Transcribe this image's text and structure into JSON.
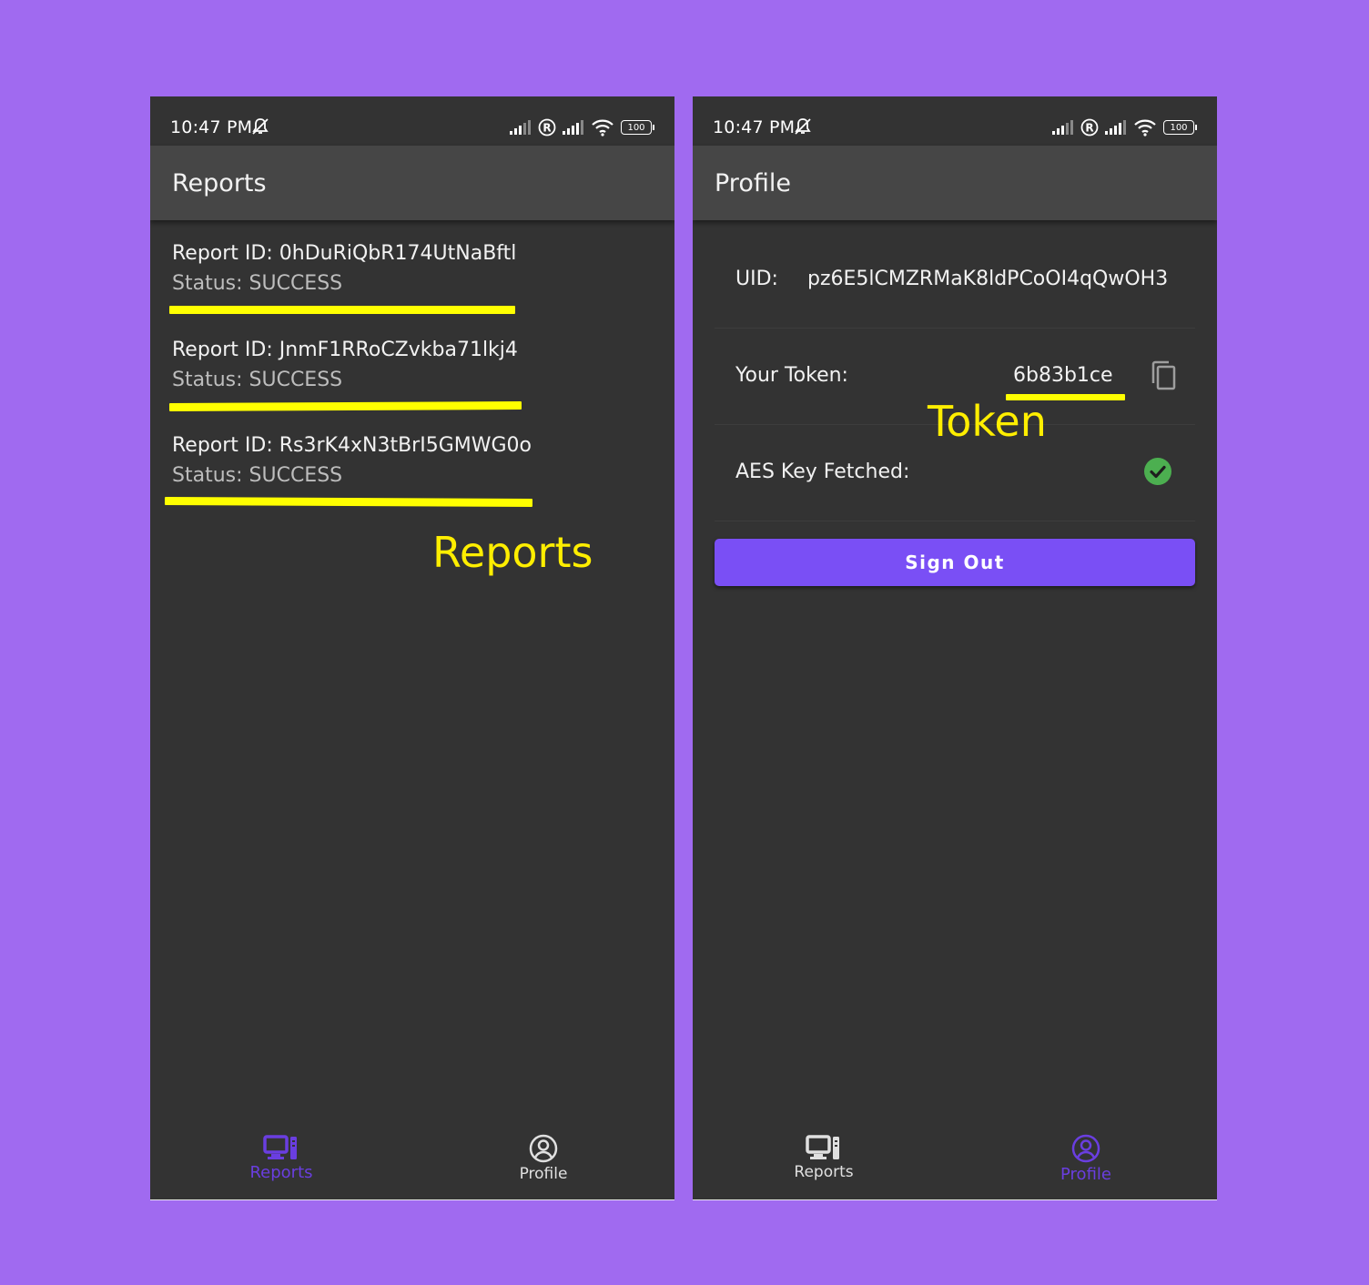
{
  "colors": {
    "background": "#a06af0",
    "surface": "#333333",
    "appbar": "#464646",
    "accent": "#7a4ff5",
    "highlight": "#ffff00",
    "success": "#4caf50"
  },
  "status_bar": {
    "time": "10:47 PM",
    "battery": "100",
    "icons": [
      "mute-icon",
      "signal-icon",
      "registered-icon",
      "signal-icon",
      "wifi-icon",
      "battery-icon"
    ]
  },
  "left_screen": {
    "title": "Reports",
    "reports": [
      {
        "id_label": "Report ID: 0hDuRiQbR174UtNaBftl",
        "status_label": "Status: SUCCESS"
      },
      {
        "id_label": "Report ID: JnmF1RRoCZvkba71lkj4",
        "status_label": "Status: SUCCESS"
      },
      {
        "id_label": "Report ID: Rs3rK4xN3tBrI5GMWG0o",
        "status_label": "Status: SUCCESS"
      }
    ],
    "annotation": "Reports",
    "nav": {
      "reports": "Reports",
      "profile": "Profile",
      "active": "reports"
    }
  },
  "right_screen": {
    "title": "Profile",
    "uid_label": "UID:",
    "uid_value": "pz6E5lCMZRMaK8ldPCoOI4qQwOH3",
    "token_label": "Your Token:",
    "token_value": "6b83b1ce",
    "aes_label": "AES Key Fetched:",
    "aes_fetched": true,
    "signout_label": "Sign Out",
    "annotation": "Token",
    "nav": {
      "reports": "Reports",
      "profile": "Profile",
      "active": "profile"
    }
  }
}
